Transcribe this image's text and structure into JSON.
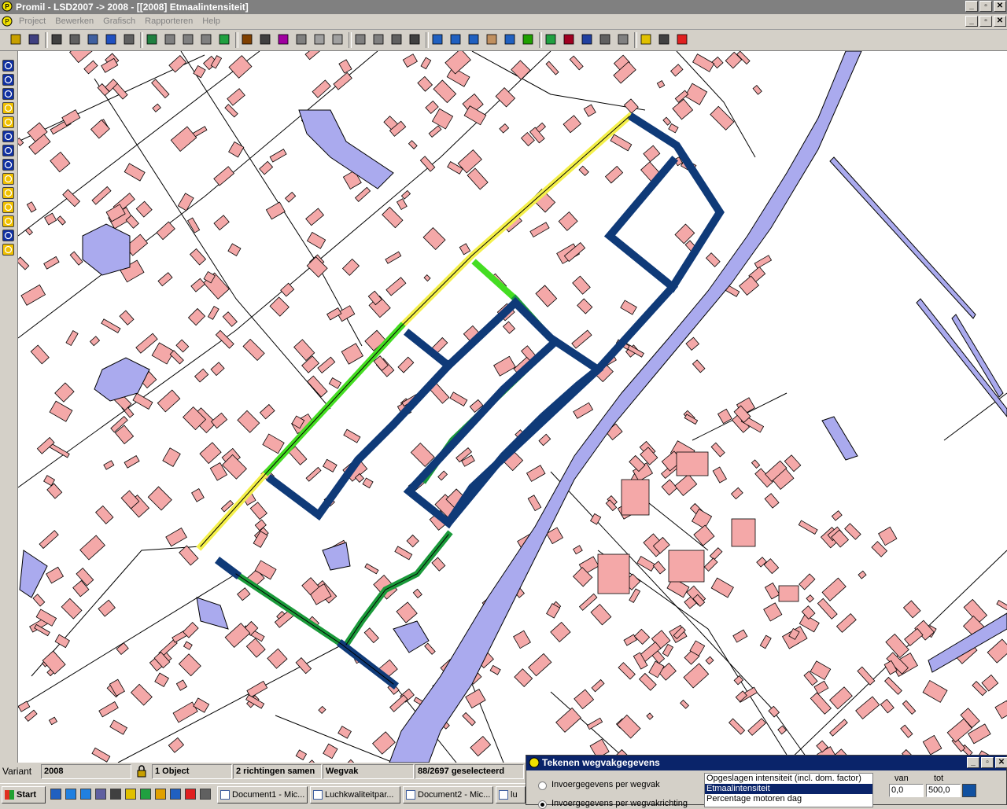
{
  "window": {
    "title": "Promil - LSD2007 -> 2008 - [[2008] Etmaalintensiteit]",
    "btn_min": "_",
    "btn_restore": "▫",
    "btn_close": "✕"
  },
  "menu": {
    "items": [
      "Project",
      "Bewerken",
      "Grafisch",
      "Rapporteren",
      "Help"
    ]
  },
  "toolbar": {
    "icons": [
      "open-folder-icon",
      "save-icon",
      "print-icon",
      "users-icon",
      "list-icon",
      "table-icon",
      "grid-icon",
      "import-icon",
      "node-icon",
      "node2-icon",
      "node3-icon",
      "map-layer-icon",
      "line-icon",
      "select-arrow-icon",
      "select-region-icon",
      "rect-select-icon",
      "triangle-icon",
      "square-icon",
      "link-icon",
      "link2-icon",
      "move-icon",
      "pan-arrow-icon",
      "zoom-in-icon",
      "zoom-out-icon",
      "zoom-all-icon",
      "hand-icon",
      "zoom-extent-icon",
      "edit-map-icon",
      "legend-icon",
      "chart-icon",
      "bar-chart-icon",
      "edit-icon",
      "document-icon",
      "help-icon",
      "calculator-icon",
      "stop-icon"
    ]
  },
  "leftbar": {
    "buttons": [
      "layer-1",
      "layer-2",
      "layer-3",
      "layer-4",
      "layer-5",
      "layer-6",
      "layer-7",
      "layer-8",
      "layer-9",
      "layer-10",
      "layer-11",
      "layer-12",
      "layer-13",
      "layer-14"
    ]
  },
  "status": {
    "variant_label": "Variant",
    "variant_value": "2008",
    "objects": "1 Object",
    "directions": "2 richtingen samen",
    "type": "Wegvak",
    "selected": "88/2697 geselecteerd"
  },
  "taskbar": {
    "start": "Start",
    "tasks": [
      "Document1 - Mic...",
      "Luchkwaliteitpar...",
      "Document2 - Mic...",
      "lu"
    ]
  },
  "dialog": {
    "title": "Tekenen wegvakgegevens",
    "radio1": "Invoergegevens per wegvak",
    "radio2": "Invoergegevens per wegvakrichting",
    "list": [
      "Opgeslagen intensiteit (incl. dom. factor)",
      "Etmaalintensiteit",
      "Percentage motoren dag"
    ],
    "selected_index": 1,
    "col_from": "van",
    "col_to": "tot",
    "from_value": "0,0",
    "to_value": "500,0"
  },
  "colors": {
    "building": "#f4a8a8",
    "water": "#aaaaee",
    "road_blue": "#0f3a78",
    "road_green": "#1a9a3a",
    "road_lightgreen": "#44dd22",
    "road_yellow": "#f4f04a",
    "swatch": "#1050a0"
  }
}
